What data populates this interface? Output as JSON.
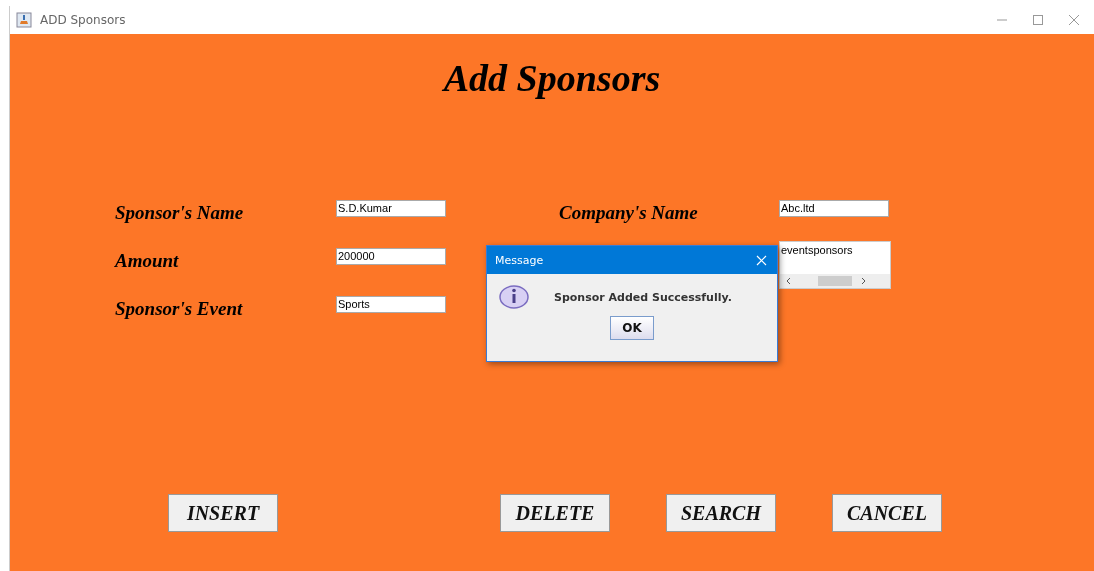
{
  "window": {
    "title": "ADD Sponsors"
  },
  "heading": "Add Sponsors",
  "fields": [
    {
      "label": "Sponsor's Name",
      "value": "S.D.Kumar"
    },
    {
      "label": "Company's Name",
      "value": "Abc.ltd"
    },
    {
      "label": "Amount",
      "value": "200000"
    },
    {
      "value": "eventsponsors",
      "kind": "textarea"
    },
    {
      "label": "Sponsor's Event",
      "value": "Sports"
    }
  ],
  "buttons": [
    "INSERT",
    "DELETE",
    "SEARCH",
    "CANCEL"
  ],
  "dialog": {
    "title": "Message",
    "message": "Sponsor Added Successfully.",
    "button": "OK"
  }
}
